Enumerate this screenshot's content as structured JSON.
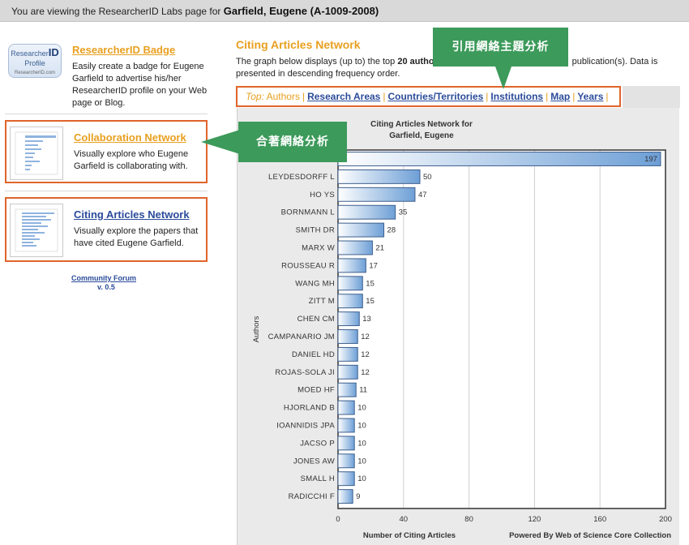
{
  "header": {
    "prefix": "You are viewing the ResearcherID Labs page for",
    "name": "Garfield, Eugene (A-1009-2008)"
  },
  "sidebar": {
    "badge_logo": {
      "line1": "Researcher",
      "line1b": "ID",
      "line2": "Profile",
      "line3": "ResearcherID.com"
    },
    "widgets": [
      {
        "title": "ResearcherID Badge",
        "desc": "Easily create a badge for Eugene Garfield to advertise his/her ResearcherID profile on your Web page or Blog."
      },
      {
        "title": "Collaboration Network",
        "desc": "Visually explore who Eugene Garfield is collaborating with."
      },
      {
        "title": "Citing Articles Network",
        "desc": "Visually explore the papers that have cited Eugene Garfield."
      }
    ],
    "forum": "Community Forum",
    "version": "v. 0.5"
  },
  "main": {
    "title": "Citing Articles Network",
    "desc_part1": "The graph below displays (up to) the top ",
    "desc_bold": "20 autho",
    "desc_part2": "publication(s). Data is presented in descending frequency order."
  },
  "tabs": {
    "top_label": "Top:",
    "items": [
      "Authors",
      "Research Areas",
      "Countries/Territories",
      "Institutions",
      "Map",
      "Years"
    ]
  },
  "callouts": {
    "top": "引用網絡主題分析",
    "mid": "合著網絡分析"
  },
  "colors": {
    "accent_orange": "#e8a020",
    "link_blue": "#2a4b9a",
    "highlight_border": "#e0642a",
    "callout_green": "#3c9a5a",
    "bar_blue": "#6d9fd6"
  },
  "chart_data": {
    "type": "bar",
    "orientation": "horizontal",
    "title": "Citing Articles Network for",
    "subtitle": "Garfield, Eugene",
    "xlabel": "Number of Citing Articles",
    "ylabel": "Authors",
    "footer": "Powered By Web of Science Core Collection",
    "xlim": [
      0,
      200
    ],
    "xticks": [
      0,
      40,
      80,
      120,
      160,
      200
    ],
    "grid": true,
    "categories": [
      "",
      "LEYDESDORFF L",
      "HO YS",
      "BORNMANN L",
      "SMITH DR",
      "MARX W",
      "ROUSSEAU R",
      "WANG MH",
      "ZITT M",
      "CHEN CM",
      "CAMPANARIO JM",
      "DANIEL HD",
      "ROJAS-SOLA JI",
      "MOED HF",
      "HJORLAND B",
      "IOANNIDIS JPA",
      "JACSO P",
      "JONES AW",
      "SMALL H",
      "RADICCHI F"
    ],
    "values": [
      197,
      50,
      47,
      35,
      28,
      21,
      17,
      15,
      15,
      13,
      12,
      12,
      12,
      11,
      10,
      10,
      10,
      10,
      10,
      9
    ]
  }
}
